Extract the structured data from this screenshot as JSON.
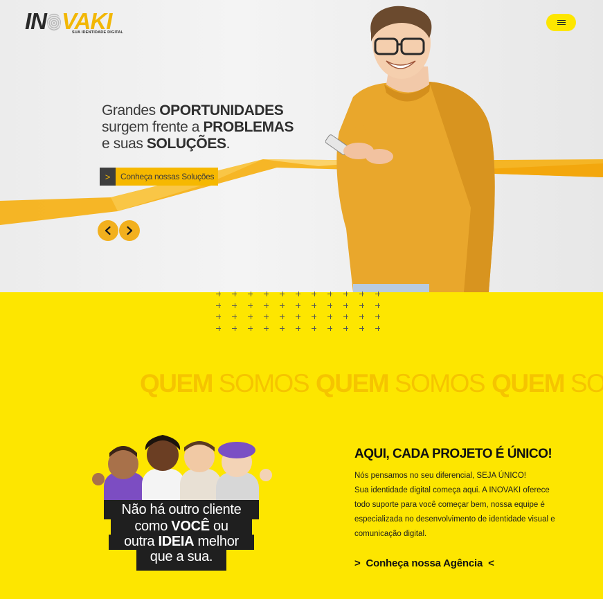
{
  "brand": {
    "logo_left": "IN",
    "logo_right": "VAKI",
    "tagline": "SUA IDENTIDADE DIGITAL",
    "accent_yellow": "#fde600",
    "accent_orange": "#f6b800",
    "dark": "#3e3e3e"
  },
  "header": {
    "menu_icon": "hamburger-icon"
  },
  "hero": {
    "headline": {
      "line1_light": "Grandes ",
      "line1_bold": "OPORTUNIDADES",
      "line2_light": "surgem frente a ",
      "line2_bold": "PROBLEMAS",
      "line3_light": "e suas ",
      "line3_bold": "SOLUÇÕES",
      "line3_end": "."
    },
    "cta": {
      "arrow": ">",
      "label": "Conheça nossas Soluções"
    },
    "prev_icon": "chevron-left-icon",
    "next_icon": "chevron-right-icon"
  },
  "about": {
    "marquee": [
      {
        "bold": "QUEM",
        "light": "SOMOS"
      },
      {
        "bold": "QUEM",
        "light": "SOMOS"
      },
      {
        "bold": "QUEM",
        "light": "SOMOS"
      }
    ],
    "quote": {
      "line1": "Não há outro cliente",
      "line2_pre": "como ",
      "line2_bold": "VOCÊ",
      "line2_post": " ou",
      "line3_pre": "outra ",
      "line3_bold": "IDEIA",
      "line3_post": " melhor",
      "line4": "que a sua."
    },
    "title": "AQUI, CADA PROJETO É ÚNICO!",
    "paragraph1": "Nós pensamos no seu diferencial,  SEJA ÚNICO!",
    "paragraph2": "Sua identidade digital começa aqui. A INOVAKI oferece todo suporte para você começar bem, nossa equipe é especializada no desenvolvimento de identidade visual e comunicação digital.",
    "link": {
      "open": ">",
      "label": "Conheça nossa Agência",
      "close": "<"
    }
  }
}
